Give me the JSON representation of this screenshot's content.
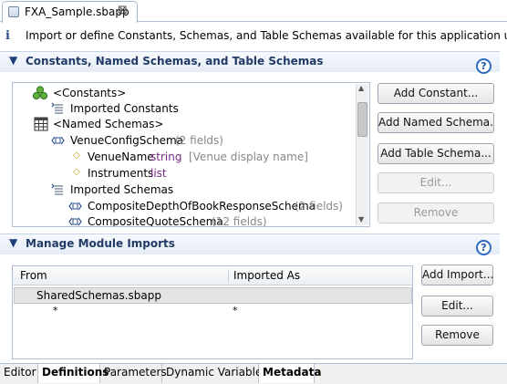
{
  "editor": {
    "tab_title": "FXA_Sample.sbapp",
    "close_glyph": "⊠"
  },
  "info": {
    "icon": "i",
    "text": "Import or define Constants, Schemas, and Table Schemas available for this application using the tab"
  },
  "constants_section": {
    "title": "Constants, Named Schemas, and Table Schemas",
    "help": "?",
    "tree": [
      {
        "label": "<Constants>",
        "detail": ""
      },
      {
        "label": "Imported Constants",
        "detail": ""
      },
      {
        "label": "<Named Schemas>",
        "detail": ""
      },
      {
        "label": "VenueConfigSchema",
        "detail": "(2 fields)"
      },
      {
        "label": "VenueName",
        "type": "string",
        "detail": "[Venue display name]"
      },
      {
        "label": "Instruments",
        "type": "list",
        "detail": ""
      },
      {
        "label": "Imported Schemas",
        "detail": ""
      },
      {
        "label": "CompositeDepthOfBookResponseSchema",
        "detail": "(2 fields)"
      },
      {
        "label": "CompositeQuoteSchema",
        "detail": "(12 fields)"
      }
    ],
    "buttons": {
      "add_constant": "Add Constant...",
      "add_named_schema": "Add Named Schema...",
      "add_table_schema": "Add Table Schema...",
      "edit": "Edit...",
      "remove": "Remove"
    }
  },
  "imports_section": {
    "title": "Manage Module Imports",
    "help": "?",
    "columns": [
      "From",
      "Imported As"
    ],
    "rows": [
      {
        "from": "SharedSchemas.sbapp",
        "as": ""
      },
      {
        "from": "*",
        "as": "*"
      }
    ],
    "buttons": {
      "add_import": "Add Import...",
      "edit": "Edit...",
      "remove": "Remove"
    }
  },
  "bottom_tabs": [
    "Editor",
    "Definitions",
    "Parameters",
    "Dynamic Variables",
    "Metadata"
  ],
  "active_bottom_tab": "Definitions"
}
